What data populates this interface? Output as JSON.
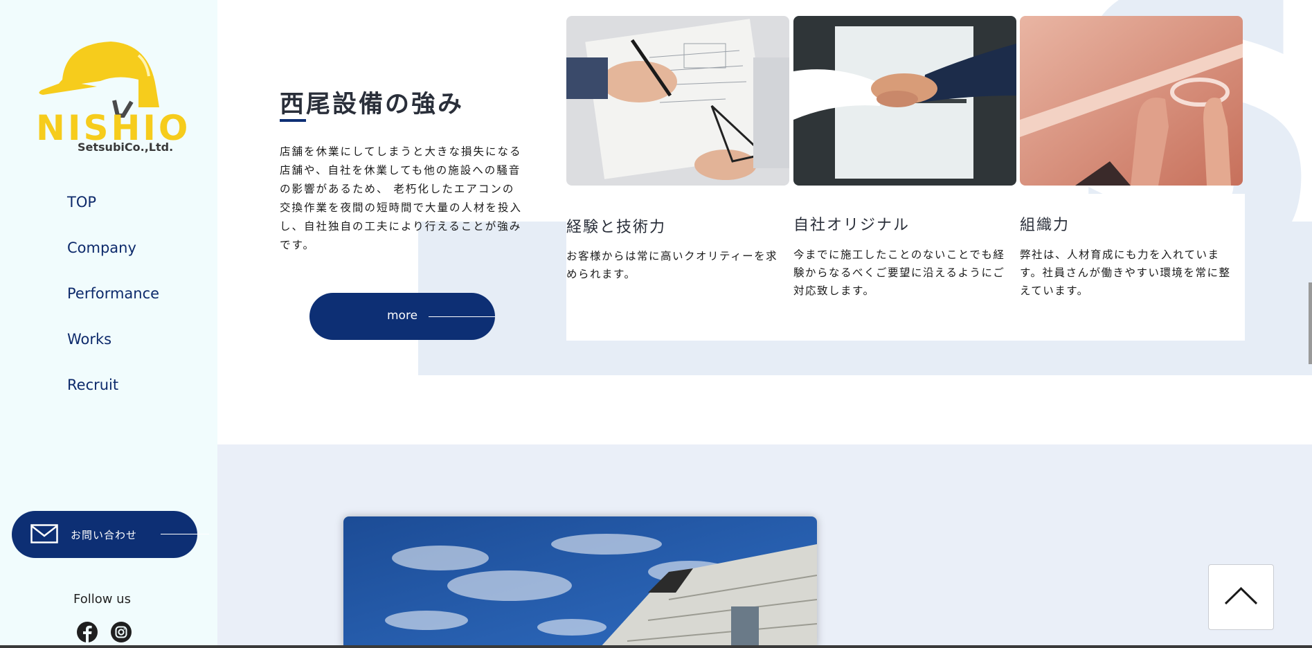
{
  "logo": {
    "name": "NISHIO",
    "sub": "SetsubiCo.,Ltd."
  },
  "nav": {
    "items": [
      "TOP",
      "Company",
      "Performance",
      "Works",
      "Recruit"
    ]
  },
  "contact": {
    "label": "お問い合わせ"
  },
  "follow": {
    "label": "Follow us"
  },
  "strength": {
    "title": "西尾設備の強み",
    "text": "店舗を休業にしてしまうと大きな損失になる店舗や、自社を休業しても他の施設への騒音の影響があるため、 老朽化したエアコンの交換作業を夜間の短時間で大量の人材を投入し、自社独自の工夫により行えることが強みです。",
    "more_label": "more",
    "cards": [
      {
        "title": "経験と技術力",
        "text": "お客様からは常に高いクオリティーを求められます。"
      },
      {
        "title": "自社オリジナル",
        "text": "今までに施工したことのないことでも経験からなるべくご要望に沿えるようにご対応致します。"
      },
      {
        "title": "組織力",
        "text": "弊社は、人材育成にも力を入れています。社員さんが働きやすい環境を常に整えています。"
      }
    ]
  },
  "colors": {
    "brand_navy": "#0d2f74",
    "logo_yellow": "#f6cc1c",
    "sidebar_bg": "#f1fcfd",
    "band_bg": "#e6edf6"
  }
}
